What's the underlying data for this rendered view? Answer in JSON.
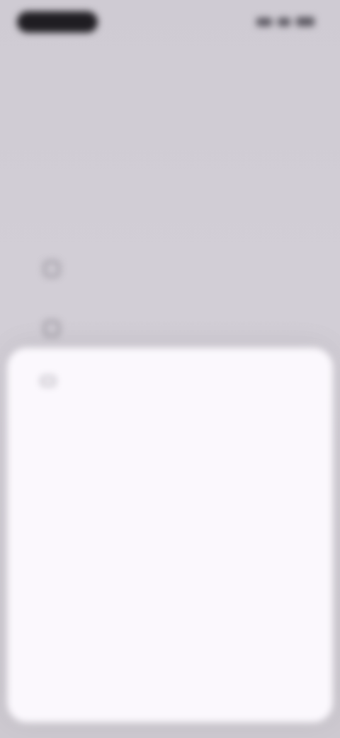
{
  "status_bar": {
    "time": "",
    "icons": [
      "signal-icon",
      "wifi-icon",
      "battery-icon"
    ]
  },
  "page": {
    "title": "",
    "subtitle": "",
    "options": [
      {
        "label": ""
      },
      {
        "label": ""
      }
    ]
  },
  "sheet": {
    "icon": "info-icon",
    "title": "",
    "paragraphs": [
      "",
      "",
      ""
    ]
  },
  "colors": {
    "background": "#cfcbd3",
    "sheet": "#fbf8fd",
    "text_dark": "#2c2a30",
    "text_muted": "#77737c"
  }
}
